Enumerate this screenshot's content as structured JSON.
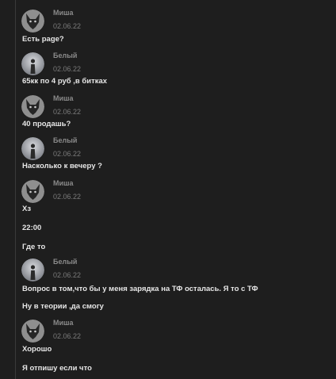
{
  "thread": {
    "posts": [
      {
        "author": "Миша",
        "date": "02.06.22",
        "avatar": "wolf-avatar-icon",
        "messages": [
          "Есть page?"
        ]
      },
      {
        "author": "Белый",
        "date": "02.06.22",
        "avatar": "person-silhouette-avatar-icon",
        "messages": [
          "65кк по 4 руб ,в битках"
        ]
      },
      {
        "author": "Миша",
        "date": "02.06.22",
        "avatar": "wolf-avatar-icon",
        "messages": [
          "40 продашь?"
        ]
      },
      {
        "author": "Белый",
        "date": "02.06.22",
        "avatar": "person-silhouette-avatar-icon",
        "messages": [
          "Насколько к вечеру ?"
        ]
      },
      {
        "author": "Миша",
        "date": "02.06.22",
        "avatar": "wolf-avatar-icon",
        "messages": [
          "Хз",
          "22:00",
          "Где то"
        ]
      },
      {
        "author": "Белый",
        "date": "02.06.22",
        "avatar": "person-silhouette-avatar-icon",
        "messages": [
          "Вопрос в том,что бы у меня зарядка на ТФ осталась. Я то с ТФ",
          "Ну в теории ,да смогу"
        ]
      },
      {
        "author": "Миша",
        "date": "02.06.22",
        "avatar": "wolf-avatar-icon",
        "messages": [
          "Хорошо",
          "Я отпишу если что"
        ]
      }
    ]
  },
  "colors": {
    "background": "#1e1e1e",
    "author": "#8a8a8a",
    "date": "#7a7a7a",
    "message": "#e6e6e6"
  }
}
